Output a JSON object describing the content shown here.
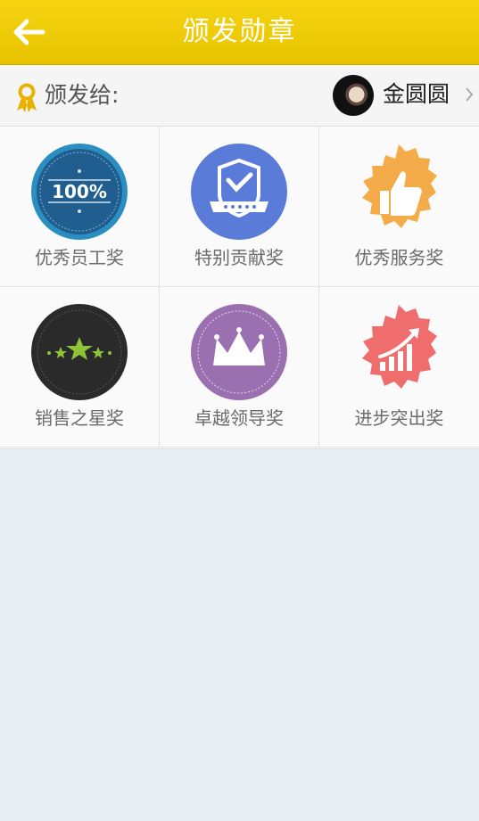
{
  "header": {
    "title": "颁发勋章",
    "back_icon": "arrow-left-icon"
  },
  "recipient": {
    "label": "颁发给:",
    "label_icon": "award-ribbon-icon",
    "user_name": "金圆圆",
    "chevron_icon": "chevron-right-icon"
  },
  "awards": [
    {
      "label": "优秀员工奖",
      "icon": "100-percent-seal-icon",
      "color": "#1f5e8f",
      "badge_text": "100%"
    },
    {
      "label": "特别贡献奖",
      "icon": "shield-check-icon",
      "color": "#5b7bd8"
    },
    {
      "label": "优秀服务奖",
      "icon": "thumbs-up-icon",
      "color": "#f4ac4a"
    },
    {
      "label": "销售之星奖",
      "icon": "stars-icon",
      "color": "#2a2a2a"
    },
    {
      "label": "卓越领导奖",
      "icon": "crown-icon",
      "color": "#9b70b0"
    },
    {
      "label": "进步突出奖",
      "icon": "growth-chart-icon",
      "color": "#f06d6d"
    }
  ],
  "colors": {
    "header": "#f0cc09",
    "background": "#e6edf3",
    "label_text": "#6b6b6b"
  }
}
